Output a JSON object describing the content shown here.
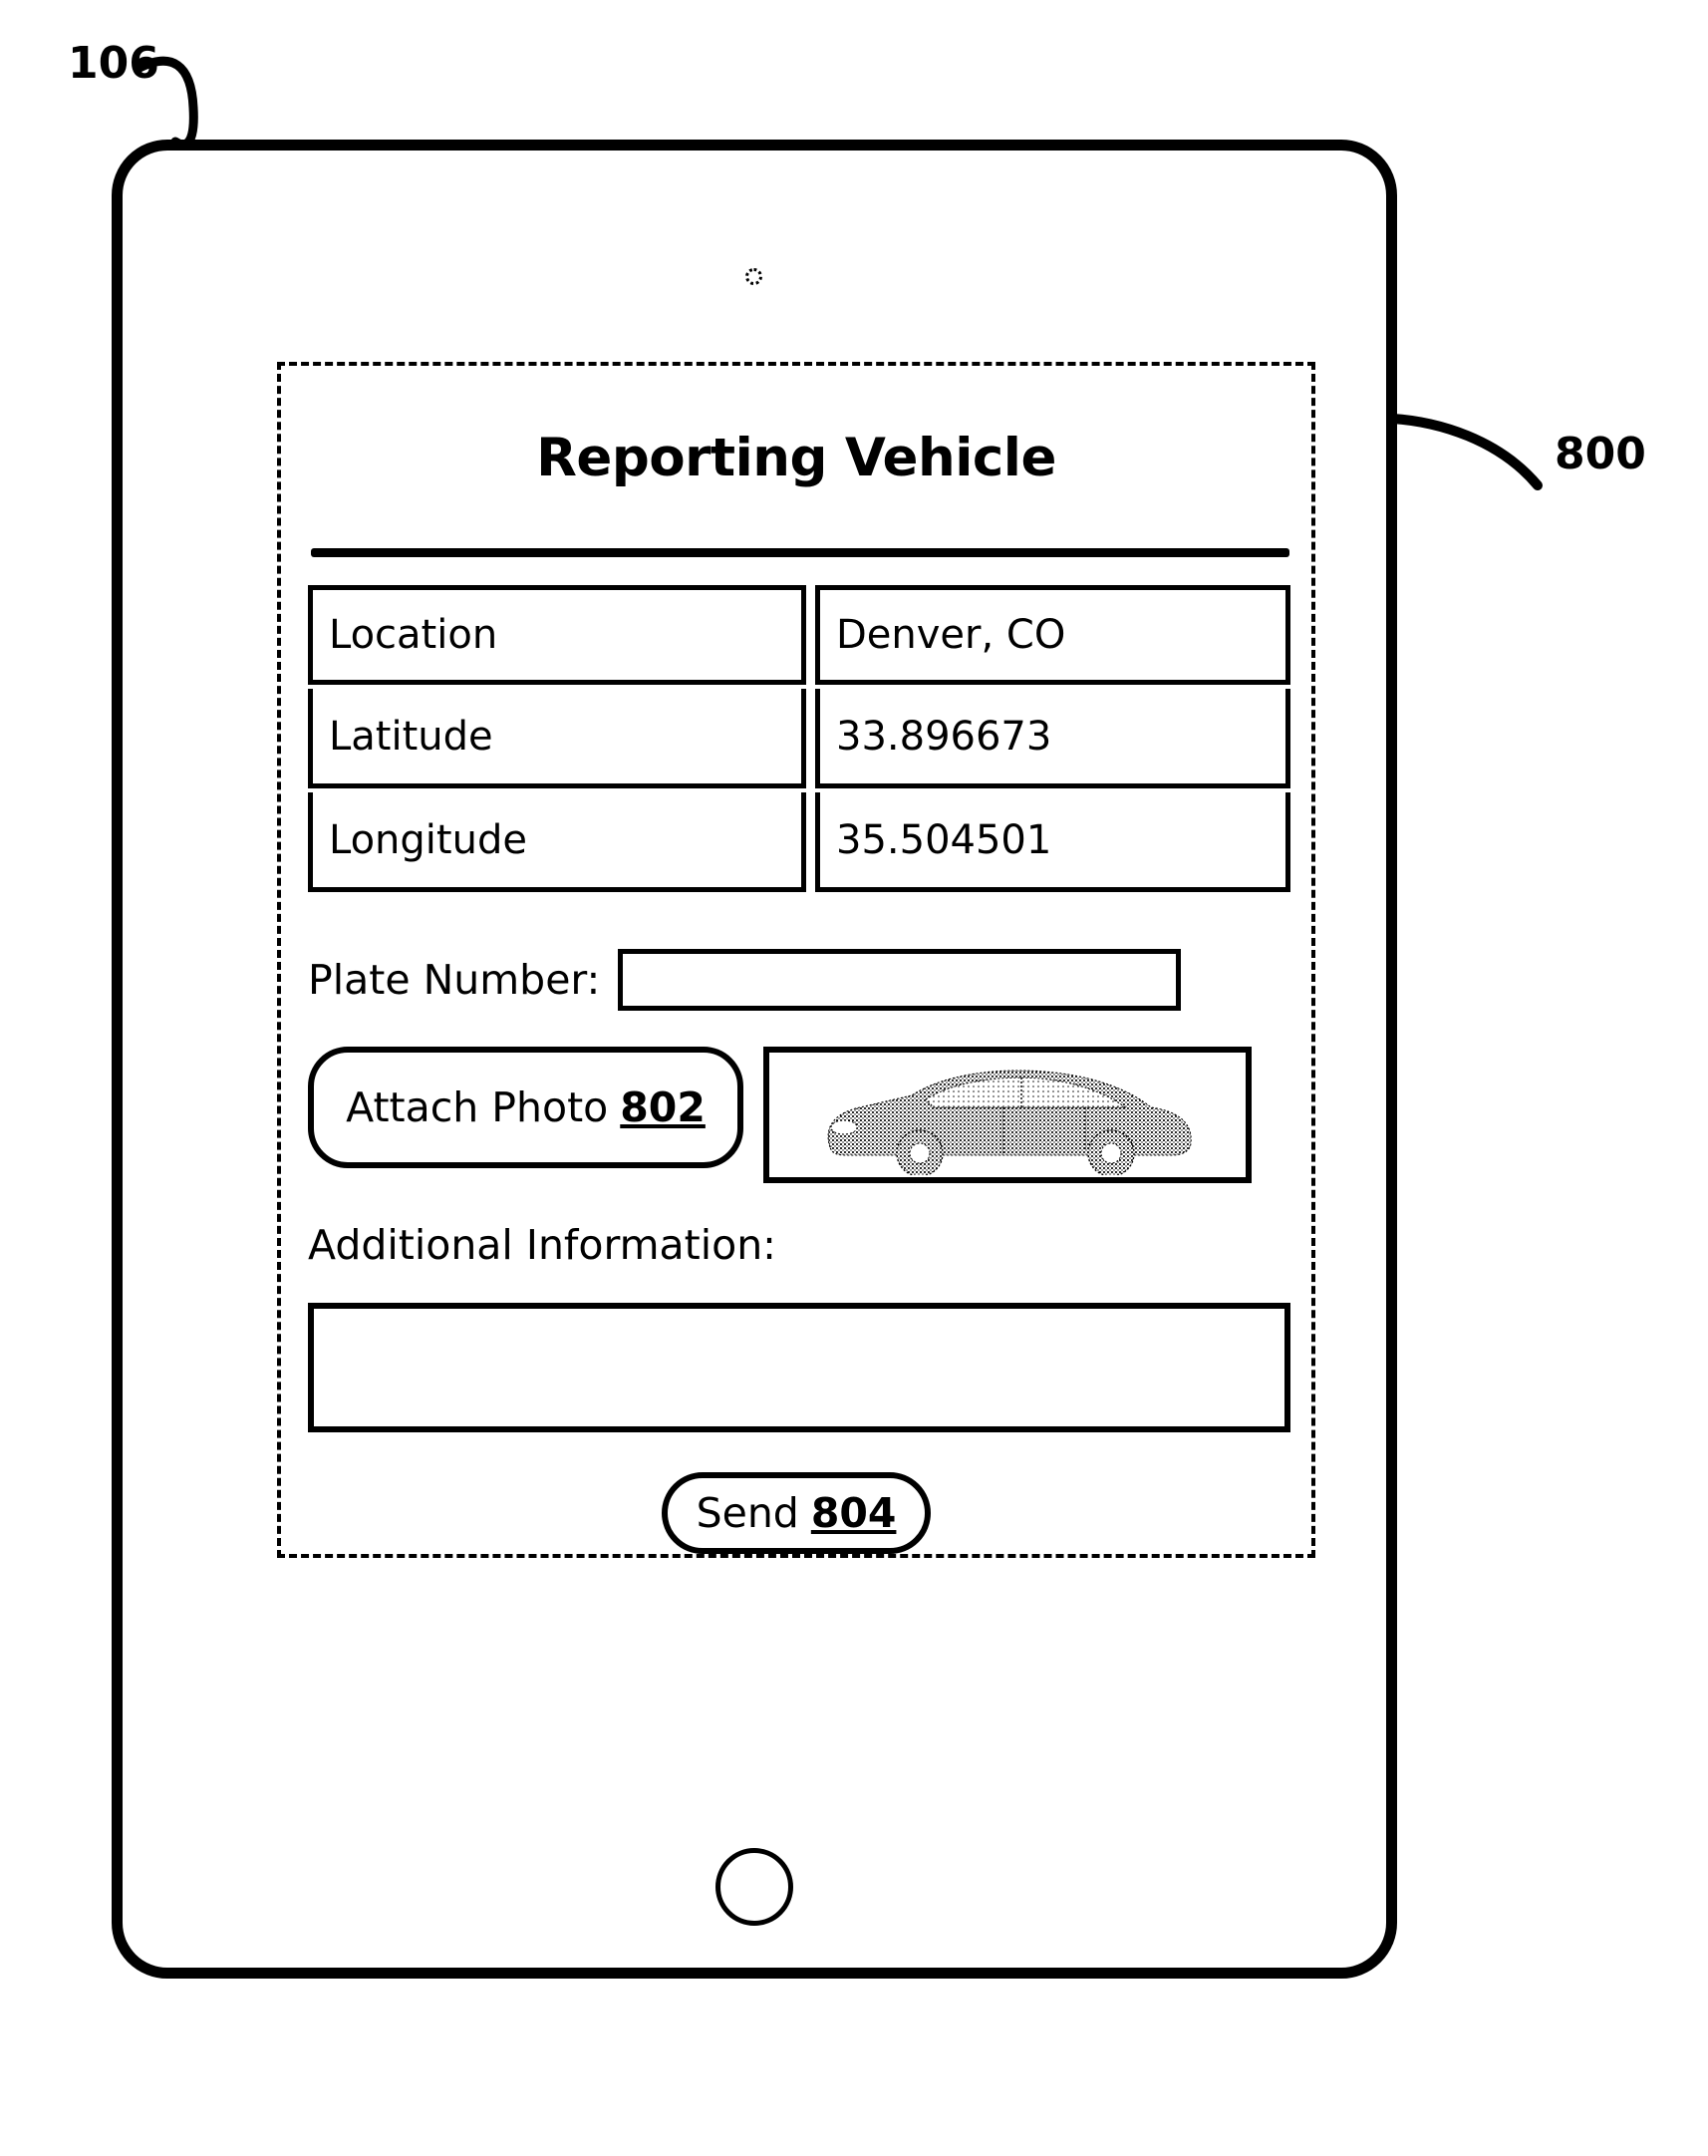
{
  "figure": {
    "device_ref": "106",
    "screen_ref": "800"
  },
  "app": {
    "title": "Reporting Vehicle",
    "table": {
      "rows": [
        {
          "label": "Location",
          "value": "Denver, CO"
        },
        {
          "label": "Latitude",
          "value": "33.896673"
        },
        {
          "label": "Longitude",
          "value": "35.504501"
        }
      ]
    },
    "plate": {
      "label": "Plate Number:",
      "value": "",
      "placeholder": ""
    },
    "attach_photo": {
      "label": "Attach Photo",
      "ref": "802"
    },
    "photo_thumbnail": {
      "alt": "car-photo"
    },
    "additional_info": {
      "label": "Additional Information:",
      "value": "",
      "placeholder": ""
    },
    "send": {
      "label": "Send",
      "ref": "804"
    }
  },
  "icons": {
    "front_camera": "camera-dot-icon",
    "home_button": "home-button-icon",
    "car": "car-photo-icon"
  },
  "colors": {
    "ink": "#000000",
    "paper": "#ffffff"
  }
}
